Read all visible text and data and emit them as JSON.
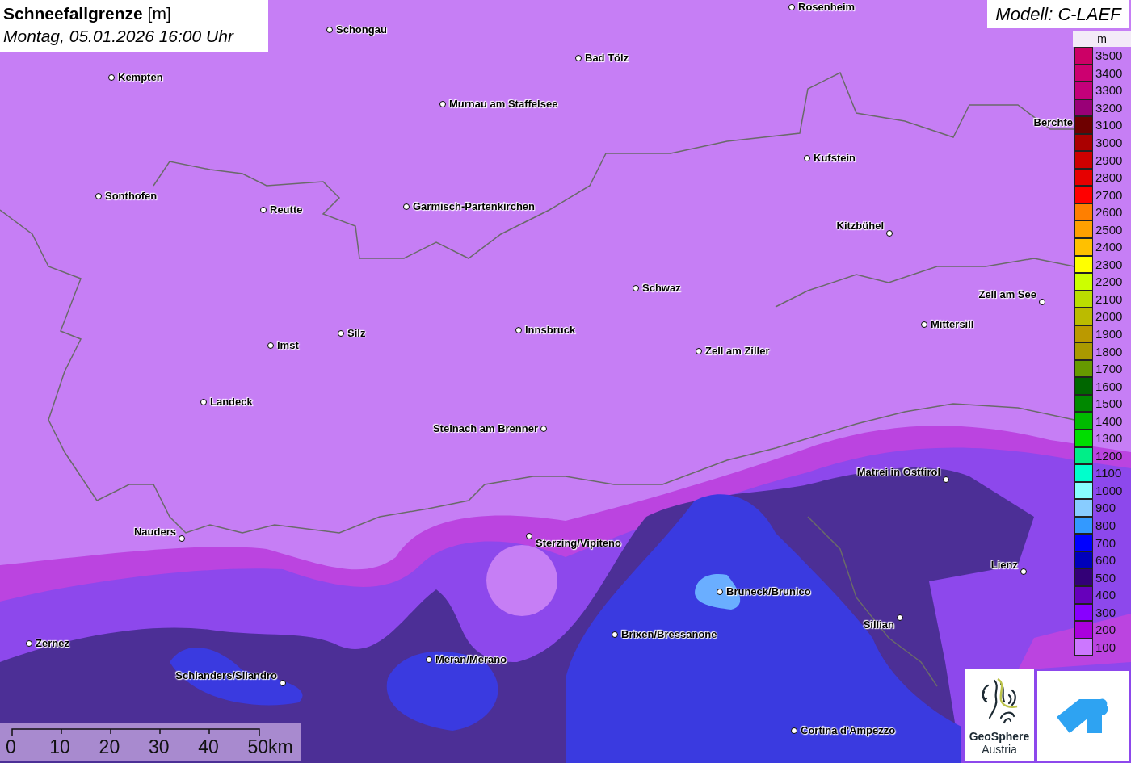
{
  "title": {
    "heading": "**Schneefallgrenze** [m]",
    "subtitle": "Montag, 05.01.2026 16:00 Uhr"
  },
  "model": "Modell: C-LAEF",
  "cities": [
    {
      "name": "Rosenheim"
    },
    {
      "name": "Schongau"
    },
    {
      "name": "Bad Tölz"
    },
    {
      "name": "Kempten"
    },
    {
      "name": "Murnau am Staffelsee"
    },
    {
      "name": "Berchte"
    },
    {
      "name": "Kufstein"
    },
    {
      "name": "Sonthofen"
    },
    {
      "name": "Reutte"
    },
    {
      "name": "Garmisch-Partenkirchen"
    },
    {
      "name": "Kitzbühel"
    },
    {
      "name": "Schwaz"
    },
    {
      "name": "Zell am See"
    },
    {
      "name": "Mittersill"
    },
    {
      "name": "Silz"
    },
    {
      "name": "Innsbruck"
    },
    {
      "name": "Imst"
    },
    {
      "name": "Zell am Ziller"
    },
    {
      "name": "Landeck"
    },
    {
      "name": "Steinach am Brenner"
    },
    {
      "name": "Matrei in Osttirol"
    },
    {
      "name": "Nauders"
    },
    {
      "name": "Sterzing/Vipiteno"
    },
    {
      "name": "Lienz"
    },
    {
      "name": "Bruneck/Brunico"
    },
    {
      "name": "Sillian"
    },
    {
      "name": "Zernez"
    },
    {
      "name": "Brixen/Bressanone"
    },
    {
      "name": "Meran/Merano"
    },
    {
      "name": "Schlanders/Silandro"
    },
    {
      "name": "Cortina d'Ampezzo"
    }
  ],
  "legend": {
    "unit": "m",
    "items": [
      {
        "label": "3500",
        "color": "#cc0066"
      },
      {
        "label": "3400",
        "color": "#cc0070"
      },
      {
        "label": "3300",
        "color": "#c4007a"
      },
      {
        "label": "3200",
        "color": "#990077"
      },
      {
        "label": "3100",
        "color": "#6e0000"
      },
      {
        "label": "3000",
        "color": "#aa0000"
      },
      {
        "label": "2900",
        "color": "#cc0000"
      },
      {
        "label": "2800",
        "color": "#e60000"
      },
      {
        "label": "2700",
        "color": "#ff0000"
      },
      {
        "label": "2600",
        "color": "#ff7f00"
      },
      {
        "label": "2500",
        "color": "#ffa000"
      },
      {
        "label": "2400",
        "color": "#ffc000"
      },
      {
        "label": "2300",
        "color": "#ffff00"
      },
      {
        "label": "2200",
        "color": "#ccff00"
      },
      {
        "label": "2100",
        "color": "#bbdd00"
      },
      {
        "label": "2000",
        "color": "#bbbb00"
      },
      {
        "label": "1900",
        "color": "#bb9900"
      },
      {
        "label": "1800",
        "color": "#aa9900"
      },
      {
        "label": "1700",
        "color": "#669900"
      },
      {
        "label": "1600",
        "color": "#006600"
      },
      {
        "label": "1500",
        "color": "#008800"
      },
      {
        "label": "1400",
        "color": "#00bb00"
      },
      {
        "label": "1300",
        "color": "#00dd00"
      },
      {
        "label": "1200",
        "color": "#00ee88"
      },
      {
        "label": "1100",
        "color": "#00ffcc"
      },
      {
        "label": "1000",
        "color": "#88ffff"
      },
      {
        "label": "900",
        "color": "#88ccff"
      },
      {
        "label": "800",
        "color": "#3399ff"
      },
      {
        "label": "700",
        "color": "#0000ff"
      },
      {
        "label": "600",
        "color": "#0000bb"
      },
      {
        "label": "500",
        "color": "#330077"
      },
      {
        "label": "400",
        "color": "#6600bb"
      },
      {
        "label": "300",
        "color": "#8800ff"
      },
      {
        "label": "200",
        "color": "#aa00dd"
      },
      {
        "label": "100",
        "color": "#cc77ff"
      }
    ]
  },
  "scale": {
    "ticks": [
      "0",
      "10",
      "20",
      "30",
      "40",
      "50km"
    ]
  },
  "logo": {
    "name": "GeoSphere",
    "subname": "Austria"
  }
}
